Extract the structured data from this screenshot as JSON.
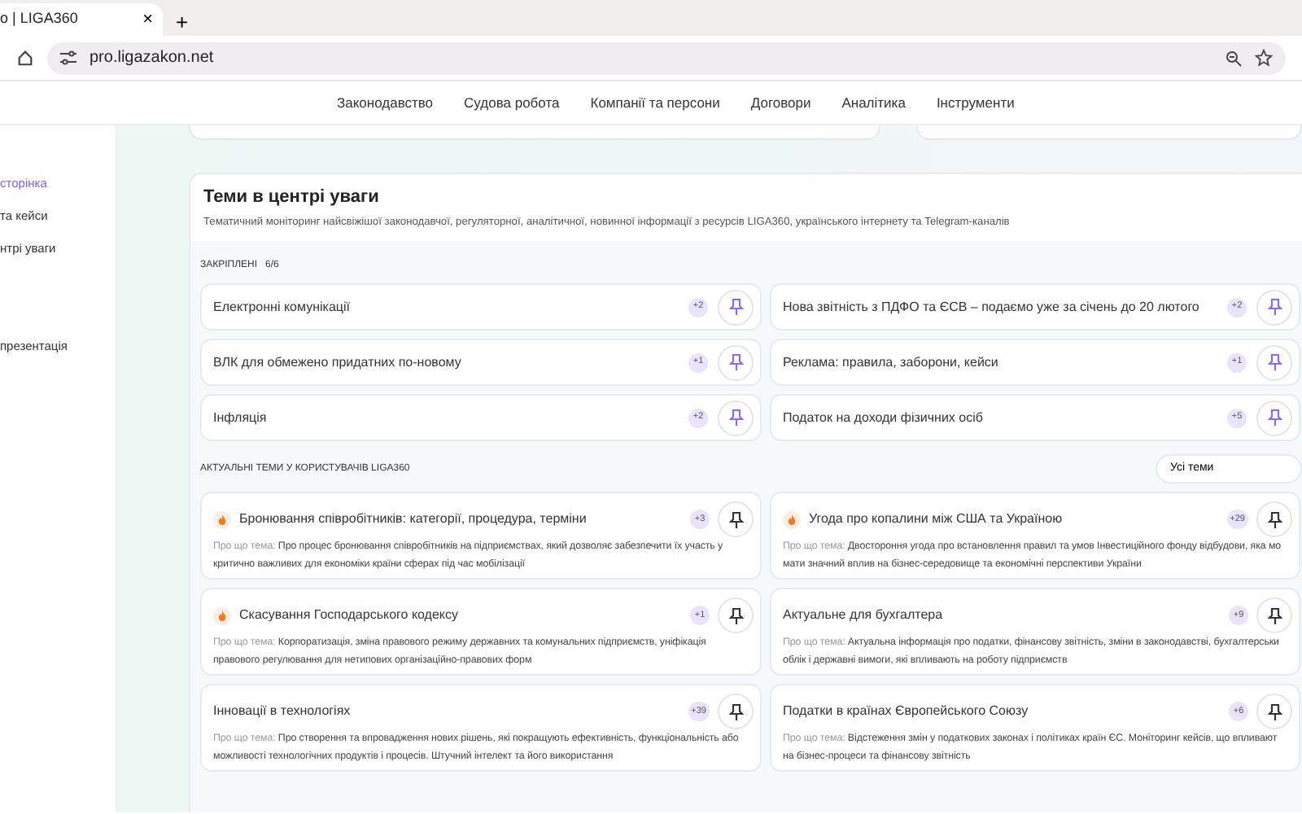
{
  "browser": {
    "tab_title": "о | LIGA360",
    "close": "×",
    "new_tab": "+",
    "url": "pro.ligazakon.net"
  },
  "nav": [
    "Законодавство",
    "Судова робота",
    "Компанії та персони",
    "Договори",
    "Аналітика",
    "Інструменти"
  ],
  "sidebar": {
    "items": [
      {
        "label": "сторінка",
        "selected": true
      },
      {
        "label": "та кейси",
        "selected": false
      },
      {
        "label": "нтрі уваги",
        "selected": false
      },
      {
        "label": "презентація",
        "selected": false
      }
    ]
  },
  "spotlight": {
    "title": "Теми в центрі уваги",
    "subtitle": "Тематичний моніторинг найсвіжішої законодавчої, регуляторної, аналітичної, новинної інформації з ресурсів LIGA360, українського інтернету та Telegram-каналів",
    "pinned": {
      "label": "ЗАКРІПЛЕНІ",
      "count": "6/6",
      "topics": [
        {
          "title": "Електронні комунікації",
          "badge": "+2",
          "pinned": true
        },
        {
          "title": "Нова звітність з ПДФО та ЄСВ – подаємо уже за січень до 20 лютого",
          "badge": "+2",
          "pinned": true
        },
        {
          "title": "ВЛК для обмежено придатних по-новому",
          "badge": "+1",
          "pinned": true
        },
        {
          "title": "Реклама: правила, заборони, кейси",
          "badge": "+1",
          "pinned": true
        },
        {
          "title": "Інфляція",
          "badge": "+2",
          "pinned": true
        },
        {
          "title": "Податок на доходи фізичних осіб",
          "badge": "+5",
          "pinned": true
        }
      ]
    },
    "trending": {
      "label": "АКТУАЛЬНІ ТЕМИ У КОРИСТУВАЧІВ LIGA360",
      "filter": "Усі теми",
      "topics": [
        {
          "title": "Бронювання співробітників: категорії, процедура, терміни",
          "hot": true,
          "badge": "+3",
          "pinned": false,
          "about_label": "Про що тема:",
          "about": "Про процес бронювання співробітників на підприємствах, який дозволяє забезпечити їх участь у критично важливих для економіки країни сферах під час мобілізації"
        },
        {
          "title": "Угода про копалини між США та Україною",
          "hot": true,
          "badge": "+29",
          "pinned": false,
          "about_label": "Про що тема:",
          "about": "Двостороння угода про встановлення правил та умов Інвестиційного фонду відбудови, яка мо мати значний вплив на бізнес-середовище та економічні перспективи України"
        },
        {
          "title": "Скасування Господарського кодексу",
          "hot": true,
          "badge": "+1",
          "pinned": false,
          "about_label": "Про що тема:",
          "about": "Корпоратизація, зміна правового режиму державних та комунальних підприємств, уніфікація правового регулювання для нетипових організаційно-правових форм"
        },
        {
          "title": "Актуальне для бухгалтера",
          "hot": false,
          "badge": "+9",
          "pinned": false,
          "about_label": "Про що тема:",
          "about": "Актуальна інформація про податки, фінансову звітність, зміни в законодавстві, бухгалтерськи облік і державні вимоги, які впливають на роботу підприємств"
        },
        {
          "title": "Інновації в технологіях",
          "hot": false,
          "badge": "+39",
          "pinned": false,
          "about_label": "Про що тема:",
          "about": "Про створення та впровадження нових рішень, які покращують ефективність, функціональність або можливості технологічних продуктів і процесів. Штучний інтелект та його використання"
        },
        {
          "title": "Податки в країнах Європейського Союзу",
          "hot": false,
          "badge": "+6",
          "pinned": false,
          "about_label": "Про що тема:",
          "about": "Відстеження змін у податкових законах і політиках країн ЄС. Моніторинг кейсів, що впливают на бізнес-процеси та фінансову звітність"
        }
      ]
    }
  }
}
